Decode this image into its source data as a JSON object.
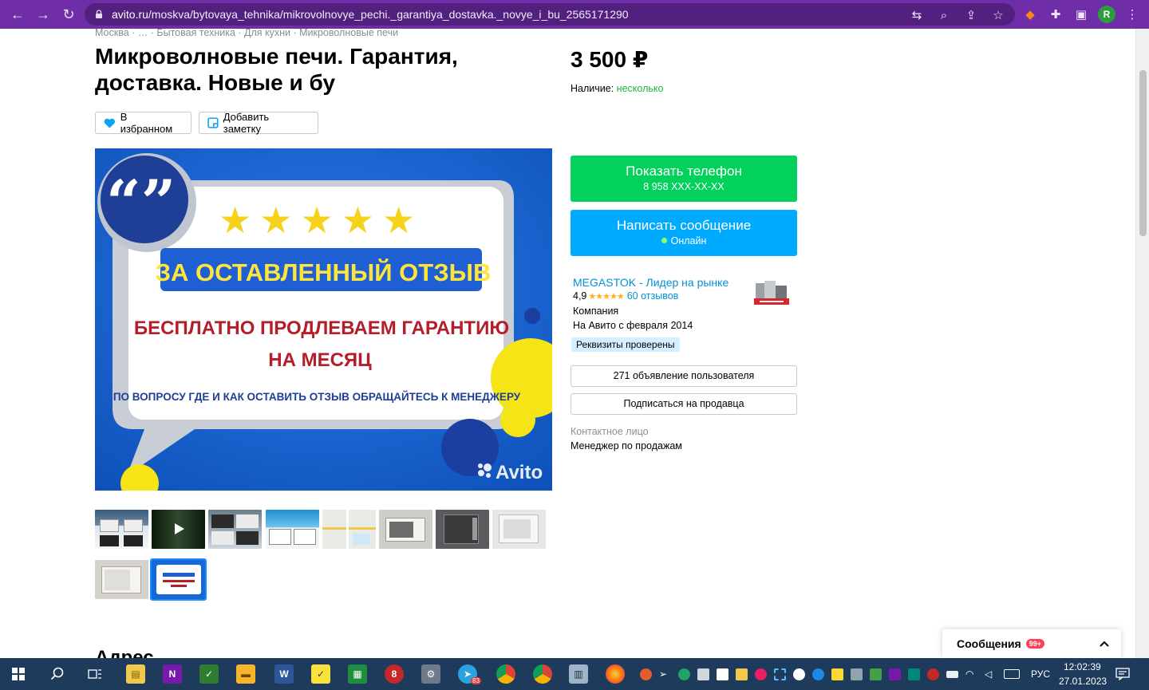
{
  "browser": {
    "url_host": "avito.ru",
    "url_path": "/moskva/bytovaya_tehnika/mikrovolnovye_pechi._garantiya_dostavka._novye_i_bu_2565171290",
    "profile_initial": "R"
  },
  "breadcrumb": "Москва · … · Бытовая техника · Для кухни · Микроволновые печи",
  "listing": {
    "title": "Микроволновые печи. Гарантия, доставка. Новые и бу",
    "price": "3 500 ₽",
    "availability_label": "Наличие:",
    "availability_value": "несколько",
    "favorite_label": "В избранном",
    "note_label": "Добавить заметку"
  },
  "image": {
    "heading": "ЗА ОСТАВЛЕННЫЙ ОТЗЫВ",
    "line1": "БЕСПЛАТНО ПРОДЛЕВАЕМ ГАРАНТИЮ",
    "line2": "НА МЕСЯЦ",
    "line3": "ПО ВОПРОСУ ГДЕ И КАК ОСТАВИТЬ ОТЗЫВ ОБРАЩАЙТЕСЬ К МЕНЕДЖЕРУ",
    "watermark": "Avito",
    "stars": "★★★★★"
  },
  "contact": {
    "show_phone": "Показать телефон",
    "phone": "8 958 XXX-XX-XX",
    "write_message": "Написать сообщение",
    "online": "Онлайн"
  },
  "seller": {
    "name": "MEGASTOK - Лидер на рынке",
    "rating": "4,9",
    "stars": "★★★★★",
    "reviews": "60 отзывов",
    "type": "Компания",
    "since": "На Авито с февраля 2014",
    "verified": "Реквизиты проверены",
    "ads_button": "271 объявление пользователя",
    "subscribe_button": "Подписаться на продавца",
    "contact_label": "Контактное лицо",
    "contact_value": "Менеджер по продажам"
  },
  "address_heading": "Адрес",
  "messages_widget": {
    "label": "Сообщения",
    "count": "99+"
  },
  "taskbar": {
    "language": "РУС",
    "time": "12:02:39",
    "date": "27.01.2023",
    "telegram_badge": "83"
  }
}
